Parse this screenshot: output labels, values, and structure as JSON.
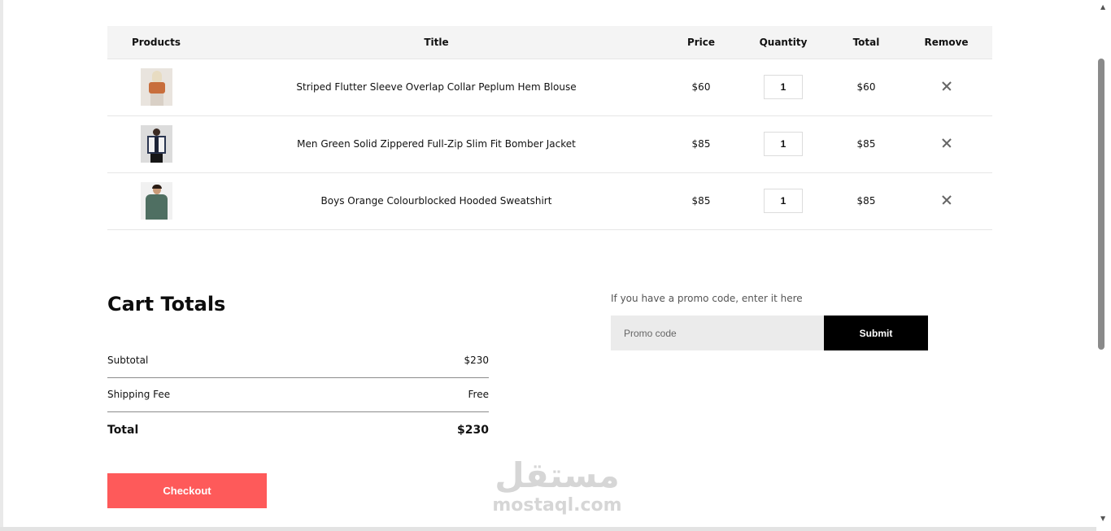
{
  "cart": {
    "headers": {
      "products": "Products",
      "title": "Title",
      "price": "Price",
      "quantity": "Quantity",
      "total": "Total",
      "remove": "Remove"
    },
    "items": [
      {
        "title": "Striped Flutter Sleeve Overlap Collar Peplum Hem Blouse",
        "price": "$60",
        "quantity": "1",
        "total": "$60"
      },
      {
        "title": "Men Green Solid Zippered Full-Zip Slim Fit Bomber Jacket",
        "price": "$85",
        "quantity": "1",
        "total": "$85"
      },
      {
        "title": "Boys Orange Colourblocked Hooded Sweatshirt",
        "price": "$85",
        "quantity": "1",
        "total": "$85"
      }
    ]
  },
  "totals": {
    "heading": "Cart Totals",
    "subtotal_label": "Subtotal",
    "subtotal_value": "$230",
    "shipping_label": "Shipping Fee",
    "shipping_value": "Free",
    "total_label": "Total",
    "total_value": "$230",
    "checkout_label": "Checkout"
  },
  "promo": {
    "label": "If you have a promo code, enter it here",
    "placeholder": "Promo code",
    "submit_label": "Submit"
  },
  "watermark": {
    "arabic": "مستقل",
    "latin": "mostaql.com"
  },
  "colors": {
    "checkout": "#fe5a5a",
    "submit": "#000000",
    "header_bg": "#f4f4f4"
  }
}
